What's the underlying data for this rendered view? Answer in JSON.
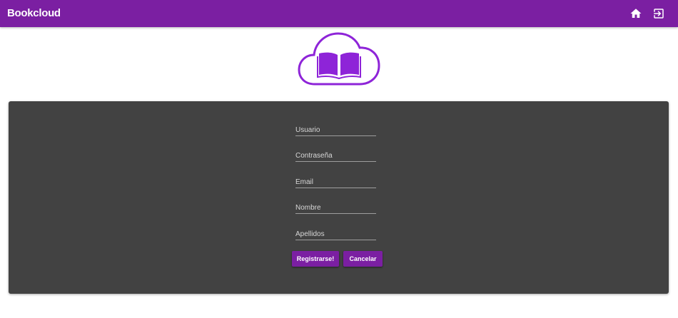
{
  "app": {
    "title": "Bookcloud",
    "accent_color": "#7b1fa2",
    "panel_color": "#424242"
  },
  "toolbar": {
    "icons": [
      "home-icon",
      "logout-icon"
    ]
  },
  "logo": {
    "icon": "cloud-book-logo",
    "color": "#8e24d8"
  },
  "form": {
    "fields": [
      {
        "name": "usuario",
        "placeholder": "Usuario",
        "value": ""
      },
      {
        "name": "contrasena",
        "placeholder": "Contraseña",
        "value": ""
      },
      {
        "name": "email",
        "placeholder": "Email",
        "value": ""
      },
      {
        "name": "nombre",
        "placeholder": "Nombre",
        "value": ""
      },
      {
        "name": "apellidos",
        "placeholder": "Apellidos",
        "value": ""
      }
    ],
    "register_label": "Registrarse!",
    "cancel_label": "Cancelar"
  }
}
